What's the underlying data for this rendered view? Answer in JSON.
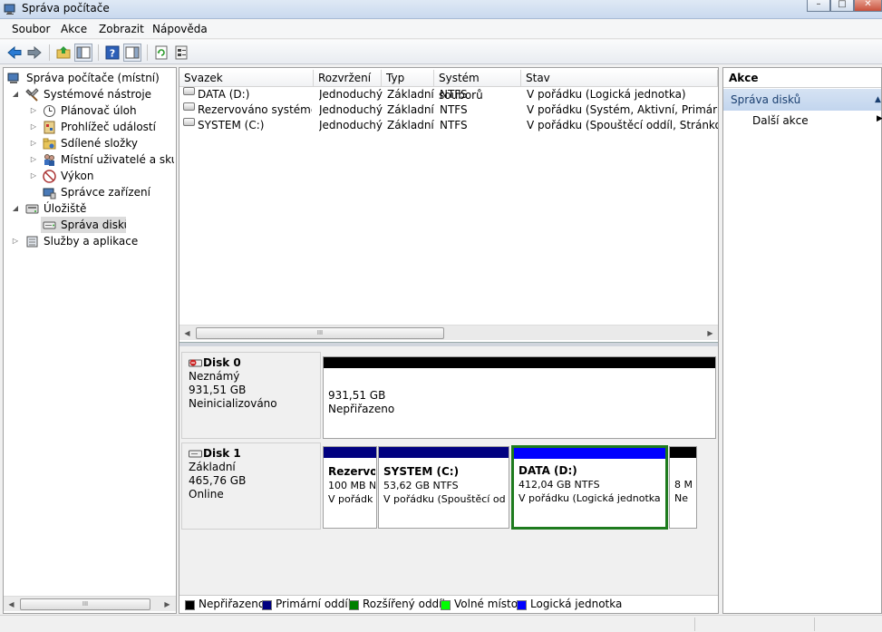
{
  "window": {
    "title": "Správa počítače",
    "controls": {
      "minimize": "–",
      "maximize": "□",
      "close": "✕"
    }
  },
  "menu": [
    "Soubor",
    "Akce",
    "Zobrazit",
    "Nápověda"
  ],
  "toolbar": {
    "icons": [
      "back-icon",
      "forward-icon",
      "up-folder-icon",
      "show-hide-tree-icon",
      "help-icon",
      "show-hide-action-pane-icon",
      "refresh-icon",
      "properties-icon"
    ]
  },
  "tree": {
    "root": "Správa počítače (místní)",
    "system_tools": "Systémové nástroje",
    "task_scheduler": "Plánovač úloh",
    "event_viewer": "Prohlížeč událostí",
    "shared_folders": "Sdílené složky",
    "local_users": "Místní uživatelé a skupiny",
    "performance": "Výkon",
    "device_manager": "Správce zařízení",
    "storage": "Úložiště",
    "disk_management": "Správa disků",
    "services": "Služby a aplikace"
  },
  "volumes": {
    "headers": [
      "Svazek",
      "Rozvržení",
      "Typ",
      "Systém souborů",
      "Stav"
    ],
    "rows": [
      [
        "DATA (D:)",
        "Jednoduchý",
        "Základní",
        "NTFS",
        "V pořádku (Logická jednotka)"
      ],
      [
        "Rezervováno systémem",
        "Jednoduchý",
        "Základní",
        "NTFS",
        "V pořádku (Systém, Aktivní, Primární oddíl)"
      ],
      [
        "SYSTEM (C:)",
        "Jednoduchý",
        "Základní",
        "NTFS",
        "V pořádku (Spouštěcí oddíl, Stránkovací soubor)"
      ]
    ]
  },
  "disks": {
    "disk0": {
      "name": "Disk 0",
      "type": "Neznámý",
      "size": "931,51 GB",
      "state": "Neinicializováno",
      "partition": {
        "size": "931,51 GB",
        "status": "Nepřiřazeno"
      }
    },
    "disk1": {
      "name": "Disk 1",
      "type": "Základní",
      "size": "465,76 GB",
      "state": "Online",
      "p1": {
        "name": "Rezervo",
        "size": "100 MB N",
        "status": "V pořádk"
      },
      "p2": {
        "name": "SYSTEM  (C:)",
        "size": "53,62 GB NTFS",
        "status": "V pořádku (Spouštěcí od"
      },
      "p3": {
        "name": "DATA  (D:)",
        "size": "412,04 GB NTFS",
        "status": "V pořádku (Logická jednotka"
      },
      "p4": {
        "size": "8 M",
        "status": "Ne"
      }
    }
  },
  "legend": [
    "Nepřiřazeno",
    "Primární oddíl",
    "Rozšířený oddíl",
    "Volné místo",
    "Logická jednotka"
  ],
  "colors": {
    "unallocated": "#000000",
    "primary": "#000080",
    "extended": "#008000",
    "free": "#00ff00",
    "logical": "#0000ff",
    "selection": "#1e7b1e"
  },
  "actions": {
    "header": "Akce",
    "section": "Správa disků",
    "more": "Další akce"
  },
  "scroll_grip": "III"
}
